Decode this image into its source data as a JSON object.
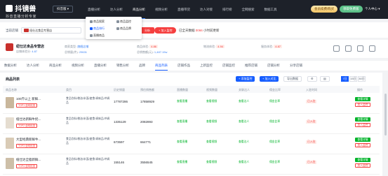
{
  "app": {
    "name": "抖镜兽",
    "tagline": "抖音直播分析专家"
  },
  "topbar": {
    "platform": "抖音版 ▾",
    "nav": [
      "直播分析",
      "达人分析",
      "商品分析",
      "视频分析",
      "直播带货",
      "达人对接",
      "排行榜",
      "全网搜索",
      "数据工具"
    ],
    "vip": "会员续费/购买",
    "gift": "领取免费版",
    "user": "个人中心 ▾"
  },
  "dropdown": {
    "items": [
      "商品搜索",
      "商品监控",
      "商品排行",
      "商品品牌",
      "直播商品",
      "新品挖掘"
    ]
  },
  "search": {
    "label": "当前店铺",
    "value": "纽仕达食品专营店",
    "btn1": "分析",
    "btn2": "+ 加入监控",
    "updated_label": "已全天数据",
    "updated_value": "0066",
    "updated_suffix": "小时前更新"
  },
  "shop": {
    "name": "纽仕达食品专营店",
    "meta_label": "店铺体验分:",
    "meta_value": "4.87",
    "stats": [
      {
        "label": "商家类型:",
        "value": "旗舰店铺"
      },
      {
        "label": "商品体验:",
        "value": "4.86"
      },
      {
        "label": "物流体验:",
        "value": "4.94"
      },
      {
        "label": "服务体验:",
        "value": "4.87"
      },
      {
        "label": "总销量(件):",
        "value": "29631"
      },
      {
        "label": "总销售额(元):",
        "value": "1,487.19w"
      }
    ]
  },
  "tabs": [
    "数据分析",
    "达人分析",
    "商品分析",
    "视频分析",
    "直播分析",
    "销售分析",
    "品牌",
    "商品列表",
    "店铺作品",
    "上新监控",
    "店铺监控",
    "推荐店铺",
    "店铺分析",
    "分享店铺"
  ],
  "active_tab": "商品列表",
  "table": {
    "title": "商品列表",
    "buttons": {
      "add_monitor": "+ 添加监控",
      "add_compare": "+ 加入对比",
      "export": "导出数据"
    },
    "periods": [
      "7日",
      "15日",
      "30日"
    ],
    "headers": [
      "商品名称",
      "类目",
      "历史销量",
      "预估销售额",
      "直播数量",
      "视频数量",
      "关联达人",
      "佣金比率",
      "入驻时间",
      "操作"
    ],
    "rows": [
      {
        "title": "100斤以上 新鲜...",
        "badge": "TOP1 全网优选",
        "cat": "食品饮料/粮油/米面/速食/调味品/冲调品",
        "sales": "17787286",
        "revenue": "17858929",
        "live": "查看直播",
        "video": "查看视频",
        "creator": "查看达人",
        "rate": "佣金比率",
        "tag": "已入驻",
        "act1": "查看详情",
        "act2": "加入监控"
      },
      {
        "title": "纽仕达新鲜牛奶...",
        "badge": "TOP2 全网优选",
        "cat": "食品饮料/粮油/米面/速食/调味品/冲调品",
        "sales": "1335129",
        "revenue": "2082893",
        "live": "查看直播",
        "video": "查看视频",
        "creator": "查看达人",
        "rate": "佣金比率",
        "tag": "已入驻",
        "act1": "查看详情",
        "act2": "加入监控"
      },
      {
        "title": "大型经典新鲜牛...",
        "badge": "TOP3 全网优选",
        "cat": "食品饮料/粮油/米面/速食/调味品/冲调品",
        "sales": "673597",
        "revenue": "664771",
        "live": "查看直播",
        "video": "查看视频",
        "creator": "查看达人",
        "rate": "佣金比率",
        "tag": "已入驻",
        "act1": "查看详情",
        "act2": "加入监控"
      },
      {
        "title": "纽仕达全脂新鲜...",
        "badge": "TOP4 全网优选",
        "cat": "食品饮料/粮油/米面/速食/调味品/冲调品",
        "sales": "155146",
        "revenue": "3556545",
        "live": "查看直播",
        "video": "查看视频",
        "creator": "查看达人",
        "rate": "佣金比率",
        "tag": "已入驻",
        "act1": "查看详情",
        "act2": "加入监控"
      }
    ]
  },
  "colors": {
    "topbar": "#1d2129",
    "primary": "#165dff",
    "danger": "#f53f3f",
    "success": "#00b42a"
  }
}
